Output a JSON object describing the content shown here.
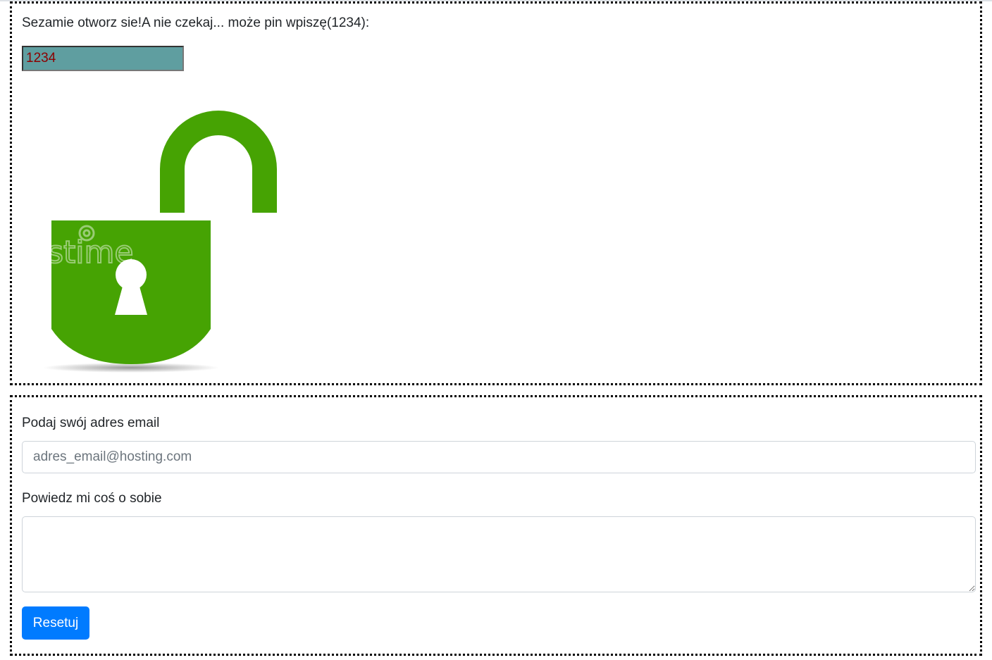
{
  "pin_section": {
    "prompt": "Sezamie otworz sie!A nie czekaj... może pin wpiszę(1234):",
    "pin_value": "1234",
    "lock_state": "unlocked",
    "lock_color": "#46a303",
    "input_bg_color": "#5f9ea0",
    "input_text_color": "#8b0000"
  },
  "form_section": {
    "email_label": "Podaj swój adres email",
    "email_placeholder": "adres_email@hosting.com",
    "about_label": "Powiedz mi coś o sobie",
    "about_value": "",
    "reset_label": "Resetuj",
    "button_color": "#007bff"
  }
}
